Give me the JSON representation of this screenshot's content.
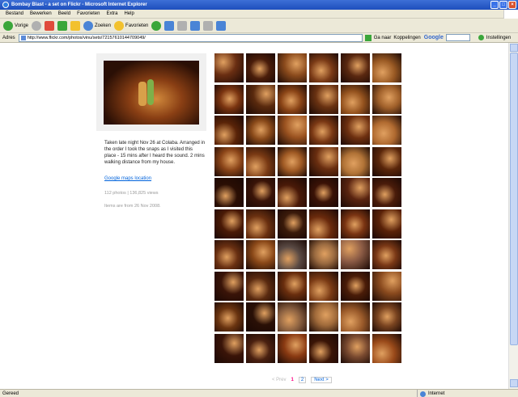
{
  "window": {
    "title": "Bombay Blast - a set on Flickr - Microsoft Internet Explorer"
  },
  "menu": [
    "Bestand",
    "Bewerken",
    "Beeld",
    "Favorieten",
    "Extra",
    "Help"
  ],
  "toolbar": {
    "back": "Vorige",
    "search": "Zoeken",
    "favorites": "Favorieten"
  },
  "address": {
    "label": "Adres",
    "url": "http://www.flickr.com/photos/vinu/sets/72157610144709049/",
    "go": "Ga naar",
    "links": "Koppelingen",
    "settings": "Instellingen"
  },
  "set": {
    "description": "Taken late night Nov 26 at Colaba. Arranged in the order I took the snaps as I visited this place - 15 mins after I heard the sound. 2 mins walking distance from my house.",
    "map_link": "Google maps location",
    "counts": "112 photos | 136,825 views",
    "date": "Items are from 26 Nov 2008."
  },
  "photos": {
    "colors": [
      "#6a2e12",
      "#4a1d0a",
      "#8a4a1c",
      "#7a3a16",
      "#5a2810",
      "#9a5a24",
      "#7a3410",
      "#5a2a0e",
      "#8a4416",
      "#6a3212",
      "#94521e",
      "#a0602a",
      "#5a2408",
      "#8a4a1a",
      "#9a5220",
      "#7a3814",
      "#6e3010",
      "#b06a30",
      "#8a4418",
      "#7a3a14",
      "#a05a24",
      "#6a2e10",
      "#b07236",
      "#5a260a",
      "#2a0e04",
      "#3a1408",
      "#4a1a08",
      "#3a1206",
      "#5a2410",
      "#4a1c0a",
      "#4a1a06",
      "#6a3010",
      "#3a1a0a",
      "#6a2a0c",
      "#7a3412",
      "#5a2208",
      "#6a3012",
      "#8a4818",
      "#5a4a44",
      "#9a6a40",
      "#8a5a44",
      "#7a3816",
      "#3a1408",
      "#5a2a10",
      "#6a2e0e",
      "#7a3a14",
      "#4a1c08",
      "#8a4a1e",
      "#6a3410",
      "#2a1006",
      "#8a6040",
      "#a06a3a",
      "#9a5a2a",
      "#7a4420",
      "#3a1408",
      "#4a2010",
      "#8a3a12",
      "#3a1406",
      "#7a4a30",
      "#9a4a1a"
    ]
  },
  "pager": {
    "prev": "< Prev",
    "pages": [
      "1",
      "2"
    ],
    "next": "Next >"
  },
  "status": {
    "left": "Gereed",
    "zone": "Internet"
  }
}
